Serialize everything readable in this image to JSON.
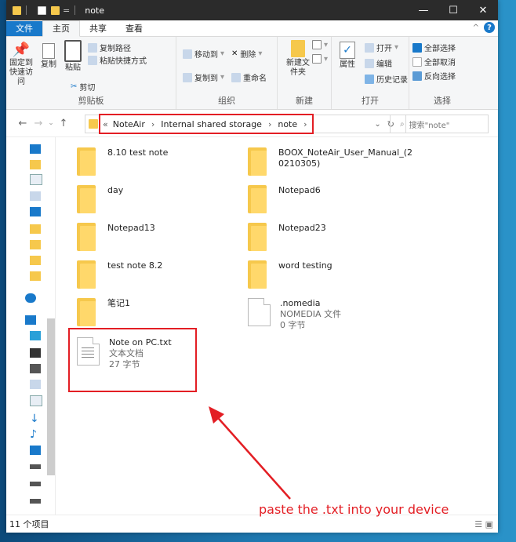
{
  "window": {
    "title": "note",
    "controls": {
      "minimize": "—",
      "maximize": "☐",
      "close": "✕"
    }
  },
  "tabs": [
    {
      "label": "文件"
    },
    {
      "label": "主页"
    },
    {
      "label": "共享"
    },
    {
      "label": "查看"
    }
  ],
  "ribbon": {
    "clipboard": {
      "pin": "固定到快速访问",
      "copy": "复制",
      "paste": "粘贴",
      "copy_path": "复制路径",
      "paste_shortcut": "粘贴快捷方式",
      "cut": "剪切",
      "label": "剪贴板"
    },
    "organize": {
      "move_to": "移动到",
      "copy_to": "复制到",
      "delete": "删除",
      "rename": "重命名",
      "label": "组织"
    },
    "new": {
      "new_folder": "新建文件夹",
      "label": "新建"
    },
    "open": {
      "properties": "属性",
      "open": "打开",
      "edit": "编辑",
      "history": "历史记录",
      "label": "打开"
    },
    "select": {
      "select_all": "全部选择",
      "select_none": "全部取消",
      "invert": "反向选择",
      "label": "选择"
    }
  },
  "address": {
    "crumbs": [
      "NoteAir",
      "Internal shared storage",
      "note"
    ],
    "search_placeholder": "搜索\"note\""
  },
  "files": [
    {
      "name": "8.10 test note",
      "type": "folder"
    },
    {
      "name": "BOOX_NoteAir_User_Manual_(2",
      "name2": "0210305)",
      "type": "folder"
    },
    {
      "name": "day",
      "type": "folder"
    },
    {
      "name": "Notepad6",
      "type": "folder"
    },
    {
      "name": "Notepad13",
      "type": "folder"
    },
    {
      "name": "Notepad23",
      "type": "folder"
    },
    {
      "name": "test note 8.2",
      "type": "folder"
    },
    {
      "name": "word testing",
      "type": "folder"
    },
    {
      "name": "笔记1",
      "type": "folder"
    },
    {
      "name": ".nomedia",
      "type": "file",
      "kind": "NOMEDIA 文件",
      "size": "0 字节"
    },
    {
      "name": "Note on PC.txt",
      "type": "file",
      "kind": "文本文档",
      "size": "27 字节"
    }
  ],
  "status": {
    "count": "11 个项目"
  },
  "annotation": "paste the .txt into your device",
  "colors": {
    "accent": "#1979ca",
    "highlight": "#e31e24",
    "folder": "#f6c84c"
  }
}
